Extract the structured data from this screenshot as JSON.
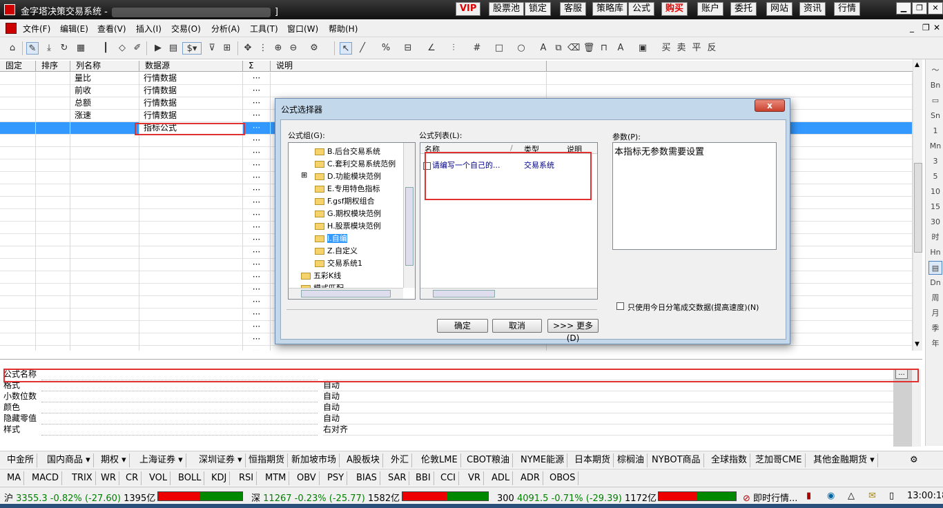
{
  "window": {
    "title": "金字塔决策交易系统 -",
    "title_suffix": "]",
    "top_buttons": [
      "VIP",
      "股票池",
      "锁定",
      "客服",
      "策略库",
      "公式",
      "购买",
      "账户",
      "委托",
      "网站",
      "资讯",
      "行情"
    ],
    "controls": [
      "▁",
      "❐",
      "✕"
    ]
  },
  "menu": {
    "items": [
      "文件(F)",
      "编辑(E)",
      "查看(V)",
      "插入(I)",
      "交易(O)",
      "分析(A)",
      "工具(T)",
      "窗口(W)",
      "帮助(H)"
    ],
    "mdi_controls": [
      "_",
      "❐",
      "✕"
    ]
  },
  "grid": {
    "headers": [
      "固定",
      "排序",
      "列名称",
      "数据源",
      "Σ",
      "说明"
    ],
    "rows": [
      {
        "name": "量比",
        "source": "行情数据",
        "sigma": "···"
      },
      {
        "name": "前收",
        "source": "行情数据",
        "sigma": "···"
      },
      {
        "name": "总额",
        "source": "行情数据",
        "sigma": "···"
      },
      {
        "name": "涨速",
        "source": "行情数据",
        "sigma": "···"
      },
      {
        "name": "",
        "source": "指标公式",
        "sigma": "···"
      },
      {
        "name": "",
        "source": "",
        "sigma": "···"
      },
      {
        "name": "",
        "source": "",
        "sigma": "···"
      },
      {
        "name": "",
        "source": "",
        "sigma": "···"
      },
      {
        "name": "",
        "source": "",
        "sigma": "···"
      },
      {
        "name": "",
        "source": "",
        "sigma": "···"
      },
      {
        "name": "",
        "source": "",
        "sigma": "···"
      },
      {
        "name": "",
        "source": "",
        "sigma": "···"
      },
      {
        "name": "",
        "source": "",
        "sigma": "···"
      },
      {
        "name": "",
        "source": "",
        "sigma": "···"
      },
      {
        "name": "",
        "source": "",
        "sigma": "···"
      },
      {
        "name": "",
        "source": "",
        "sigma": "···"
      },
      {
        "name": "",
        "source": "",
        "sigma": "···"
      },
      {
        "name": "",
        "source": "",
        "sigma": "···"
      },
      {
        "name": "",
        "source": "",
        "sigma": "···"
      },
      {
        "name": "",
        "source": "",
        "sigma": "···"
      },
      {
        "name": "",
        "source": "",
        "sigma": "···"
      },
      {
        "name": "",
        "source": "",
        "sigma": "···"
      },
      {
        "name": "",
        "source": "",
        "sigma": "···"
      }
    ]
  },
  "right_toolbar": [
    "～",
    "Bn",
    "▭",
    "Sn",
    "1",
    "Mn",
    "3",
    "5",
    "10",
    "15",
    "30",
    "时",
    "Hn",
    "▤",
    "Dn",
    "周",
    "月",
    "季",
    "年"
  ],
  "properties": {
    "rows": [
      {
        "label": "公式名称",
        "value": ""
      },
      {
        "label": "格式",
        "value": "自动"
      },
      {
        "label": "小数位数",
        "value": "自动"
      },
      {
        "label": "颜色",
        "value": "自动"
      },
      {
        "label": "隐藏零值",
        "value": "自动"
      },
      {
        "label": "样式",
        "value": "右对齐"
      }
    ],
    "browse_button": "..."
  },
  "dialog": {
    "title": "公式选择器",
    "close_label": "x",
    "group_label": "公式组(G):",
    "list_label": "公式列表(L):",
    "param_label": "参数(P):",
    "tree": [
      {
        "label": "B.后台交易系统",
        "highlight": false
      },
      {
        "label": "C.套利交易系统范例",
        "highlight": false
      },
      {
        "label": "D.功能模块范例",
        "highlight": false,
        "expander": "⊞"
      },
      {
        "label": "E.专用特色指标",
        "highlight": false
      },
      {
        "label": "F.gsf期权组合",
        "highlight": false
      },
      {
        "label": "G.期权模块范例",
        "highlight": false
      },
      {
        "label": "H.股票模块范例",
        "highlight": false
      },
      {
        "label": "I.自编",
        "highlight": true
      },
      {
        "label": "Z.自定义",
        "highlight": false
      },
      {
        "label": "交易系统1",
        "highlight": false
      },
      {
        "label": "五彩K线",
        "highlight": false,
        "root": true
      },
      {
        "label": "模式匹配",
        "highlight": false,
        "root": true
      }
    ],
    "list_headers": [
      "名称",
      "/",
      "类型",
      "说明"
    ],
    "list_rows": [
      {
        "name": "请编写一个自己的...",
        "type": "交易系统"
      }
    ],
    "param_text": "本指标无参数需要设置",
    "checkbox_label": "只使用今日分笔成交数据(提高速度)(N)",
    "buttons": {
      "ok": "确定",
      "cancel": "取消",
      "more": ">>> 更多(D)"
    }
  },
  "tabs_row1": [
    "中金所",
    "国内商品 ▾",
    "期权 ▾",
    "上海证券 ▾",
    "深圳证券 ▾",
    "恒指期货",
    "新加坡市场",
    "A股板块",
    "外汇",
    "伦敦LME",
    "CBOT粮油",
    "NYME能源",
    "日本期货",
    "棕榈油",
    "NYBOT商品",
    "全球指数",
    "芝加哥CME",
    "其他金融期货 ▾"
  ],
  "tabs_row2": [
    "MA",
    "MACD",
    "TRIX",
    "WR",
    "CR",
    "VOL",
    "BOLL",
    "KDJ",
    "RSI",
    "MTM",
    "OBV",
    "PSY",
    "BIAS",
    "SAR",
    "BBI",
    "CCI",
    "VR",
    "ADL",
    "ADR",
    "OBOS"
  ],
  "status": {
    "sh": {
      "label": "沪",
      "value": "3355.3",
      "pct": "-0.82%",
      "chg": "(-27.60)",
      "amt": "1395亿"
    },
    "sz": {
      "label": "深",
      "value": "11267",
      "pct": "-0.23%",
      "chg": "(-25.77)",
      "amt": "1582亿"
    },
    "i300": {
      "label": "300",
      "value": "4091.5",
      "pct": "-0.71%",
      "chg": "(-29.39)",
      "amt": "1172亿"
    },
    "realtime": "即时行情...",
    "time": "13:00:18"
  },
  "colors": {
    "accent_red": "#e00000",
    "selection": "#3399ff",
    "down": "#008000"
  }
}
